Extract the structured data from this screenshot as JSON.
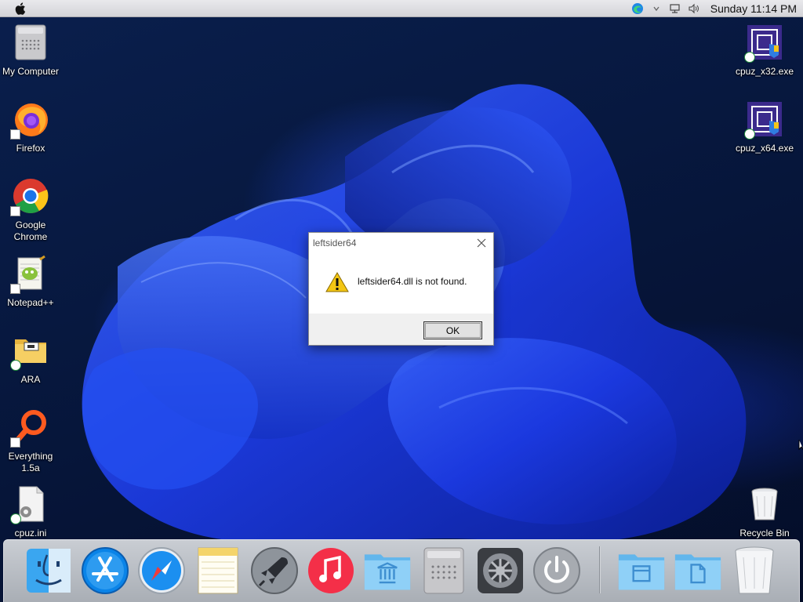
{
  "menubar": {
    "apple_icon": "apple-icon",
    "tray_icons": [
      "edge-icon",
      "chevron-down-icon",
      "network-icon",
      "volume-icon"
    ],
    "clock": "Sunday 11:14 PM"
  },
  "desktop_left": [
    {
      "label": "My Computer",
      "icon": "computer-icon"
    },
    {
      "label": "Firefox",
      "icon": "firefox-icon"
    },
    {
      "label": "Google Chrome",
      "icon": "chrome-icon"
    },
    {
      "label": "Notepad++",
      "icon": "notepadpp-icon"
    },
    {
      "label": "ARA",
      "icon": "folder-icon"
    },
    {
      "label": "Everything 1.5a",
      "icon": "everything-icon"
    },
    {
      "label": "cpuz.ini",
      "icon": "ini-file-icon"
    }
  ],
  "desktop_right": [
    {
      "label": "cpuz_x32.exe",
      "icon": "cpuz-icon"
    },
    {
      "label": "cpuz_x64.exe",
      "icon": "cpuz-icon"
    },
    {
      "label": "Recycle Bin",
      "icon": "recycle-bin-icon"
    }
  ],
  "dialog": {
    "title": "leftsider64",
    "message": "leftsider64.dll is not found.",
    "ok_label": "OK",
    "icon": "warning-icon"
  },
  "dock": {
    "items": [
      "finder-icon",
      "app-store-icon",
      "safari-icon",
      "notes-icon",
      "launchpad-icon",
      "music-icon",
      "applications-folder-icon",
      "mac-pro-icon",
      "system-preferences-icon",
      "power-icon",
      "documents-folder-icon",
      "downloads-folder-icon",
      "trash-icon"
    ]
  },
  "colors": {
    "accent_blue": "#1f4fff",
    "warning_yellow": "#f3c614"
  }
}
